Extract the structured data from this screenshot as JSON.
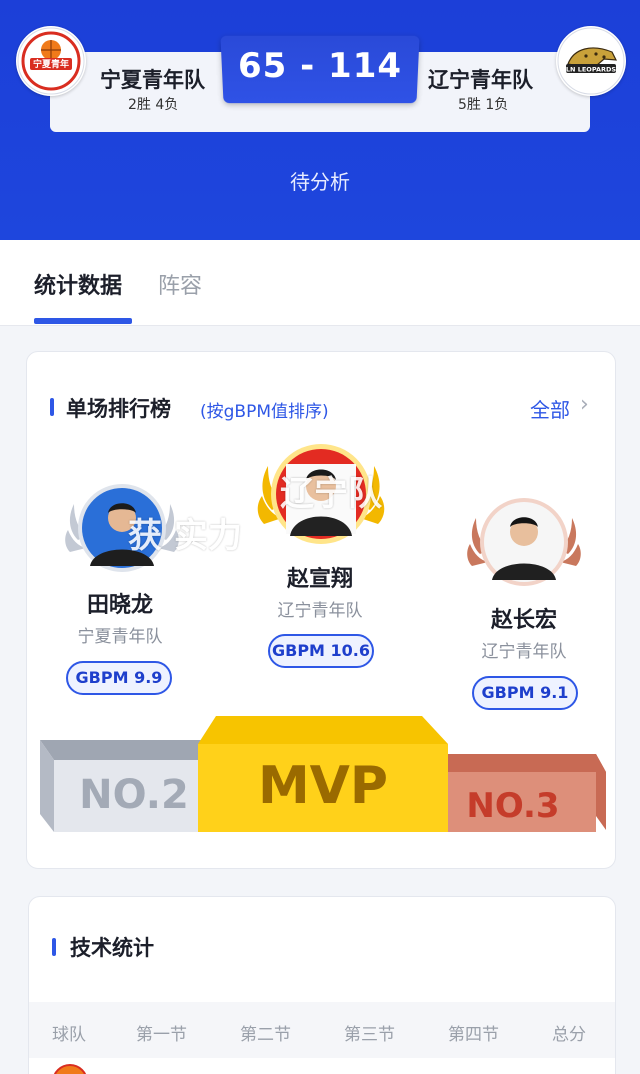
{
  "match": {
    "home": {
      "name": "宁夏青年队",
      "record": "2胜 4负",
      "logo_text": "宁夏青年"
    },
    "away": {
      "name": "辽宁青年队",
      "record": "5胜 1负",
      "logo_text": "LN LEOPARDS"
    },
    "score": "65 - 114",
    "status": "待分析"
  },
  "tabs": [
    {
      "label": "统计数据",
      "active": true
    },
    {
      "label": "阵容",
      "active": false
    }
  ],
  "ranking": {
    "title": "单场排行榜",
    "subtitle": "(按gBPM值排序)",
    "all_label": "全部",
    "players": [
      {
        "rank": "NO.2",
        "name": "田晓龙",
        "team": "宁夏青年队",
        "gbpm": "GBPM 9.9",
        "medal": "silver"
      },
      {
        "rank": "MVP",
        "name": "赵宣翔",
        "team": "辽宁青年队",
        "gbpm": "GBPM 10.6",
        "medal": "gold"
      },
      {
        "rank": "NO.3",
        "name": "赵长宏",
        "team": "辽宁青年队",
        "gbpm": "GBPM 9.1",
        "medal": "bronze"
      }
    ],
    "overlay": {
      "line1": "辽宁队",
      "line2": "获 实力"
    }
  },
  "tech_stats": {
    "title": "技术统计",
    "columns": [
      "球队",
      "第一节",
      "第二节",
      "第三节",
      "第四节",
      "总分"
    ]
  },
  "colors": {
    "brand_blue": "#2e57e6",
    "header_blue": "#1e46dd",
    "gold": "#f7c400",
    "silver": "#c7ccd6",
    "bronze": "#d9826a"
  }
}
